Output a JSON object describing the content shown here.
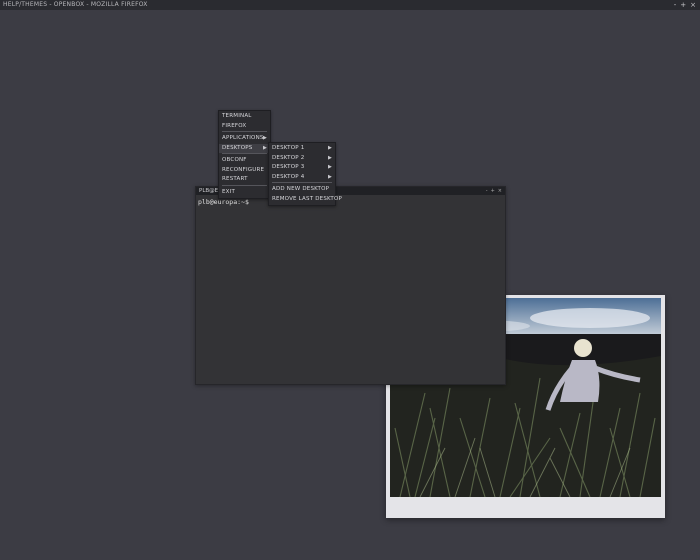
{
  "window": {
    "title": "HELP/THEMES - OPENBOX - MOZILLA FIREFOX",
    "controls": [
      "-",
      "+",
      "×"
    ]
  },
  "root_menu": {
    "items": [
      {
        "label": "TERMINAL"
      },
      {
        "label": "FIREFOX"
      },
      {
        "label": "APPLICATIONS",
        "submenu": true
      },
      {
        "label": "DESKTOPS",
        "submenu": true,
        "active": true
      },
      {
        "label": "OBCONF"
      },
      {
        "label": "RECONFIGURE"
      },
      {
        "label": "RESTART"
      },
      {
        "label": "EXIT"
      }
    ]
  },
  "desktops_menu": {
    "items": [
      {
        "label": "DESKTOP 1",
        "submenu": true
      },
      {
        "label": "DESKTOP 2",
        "submenu": true
      },
      {
        "label": "DESKTOP 3",
        "submenu": true
      },
      {
        "label": "DESKTOP 4",
        "submenu": true
      },
      {
        "label": "ADD NEW DESKTOP"
      },
      {
        "label": "REMOVE LAST DESKTOP"
      }
    ]
  },
  "terminal": {
    "title": "PLB@EU",
    "prompt": "plb@europa:~$",
    "controls": [
      "-",
      "+",
      "×"
    ]
  },
  "colors": {
    "desktop_bg": "#3c3c44",
    "menu_bg": "#2c2c30",
    "menu_text": "#d7d7db",
    "terminal_bg": "#333336"
  }
}
